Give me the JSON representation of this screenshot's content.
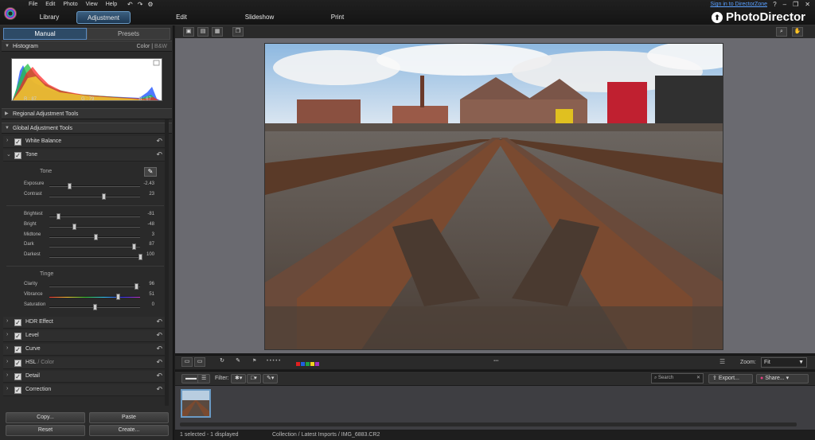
{
  "menu": {
    "items": [
      "File",
      "Edit",
      "Photo",
      "View",
      "Help"
    ]
  },
  "tabs": [
    {
      "label": "Library"
    },
    {
      "label": "Adjustment"
    },
    {
      "label": "Edit"
    },
    {
      "label": "Slideshow"
    },
    {
      "label": "Print"
    }
  ],
  "header": {
    "sign_in": "Sign in to DirectorZone",
    "brand": "PhotoDirector",
    "help": "?"
  },
  "left": {
    "subtabs": [
      "Manual",
      "Presets"
    ],
    "histogram": {
      "title": "Histogram",
      "mode_color": "Color",
      "mode_sep": "|",
      "mode_bw": "B&W",
      "r": "R : 87",
      "g": "G : 79",
      "b": "B : 67"
    },
    "regional": "Regional Adjustment Tools",
    "global": "Global Adjustment Tools",
    "white_balance": "White Balance",
    "tone": "Tone",
    "tone_sub": "Tone",
    "sliders_tone": [
      {
        "label": "Exposure",
        "value": "-2.43",
        "pos": 0.22
      },
      {
        "label": "Contrast",
        "value": "23",
        "pos": 0.6
      }
    ],
    "sliders_range": [
      {
        "label": "Brightest",
        "value": "-81",
        "pos": 0.1
      },
      {
        "label": "Bright",
        "value": "-48",
        "pos": 0.27
      },
      {
        "label": "Midtone",
        "value": "3",
        "pos": 0.51
      },
      {
        "label": "Dark",
        "value": "87",
        "pos": 0.93
      },
      {
        "label": "Darkest",
        "value": "100",
        "pos": 1.0
      }
    ],
    "tinge_sub": "Tinge",
    "sliders_tinge": [
      {
        "label": "Clarity",
        "value": "96",
        "pos": 0.96
      },
      {
        "label": "Vibrance",
        "value": "51",
        "pos": 0.75
      },
      {
        "label": "Saturation",
        "value": "0",
        "pos": 0.5
      }
    ],
    "tools": [
      "HDR Effect",
      "Level",
      "Curve"
    ],
    "hsl": "HSL",
    "hsl_sep": "/",
    "hsl_color": "Color",
    "tools2": [
      "Detail",
      "Correction"
    ],
    "buttons": {
      "copy": "Copy...",
      "paste": "Paste",
      "reset": "Reset",
      "create": "Create..."
    }
  },
  "browse": {
    "zoom_label": "Zoom:",
    "zoom_value": "Fit",
    "flag_dots": "• • • • •"
  },
  "filter": {
    "label": "Filter:",
    "search_placeholder": "Search",
    "export": "Export...",
    "share": "Share..."
  },
  "status": {
    "selected": "1 selected - 1 displayed",
    "path": "Collection / Latest Imports / IMG_6883.CR2"
  },
  "colors": {
    "accent": "#6a9ac4",
    "red": "#e02020",
    "orange": "#f08020",
    "green": "#20a040",
    "blue": "#2060e0",
    "yellow": "#f0d020",
    "purple": "#a030c0"
  }
}
